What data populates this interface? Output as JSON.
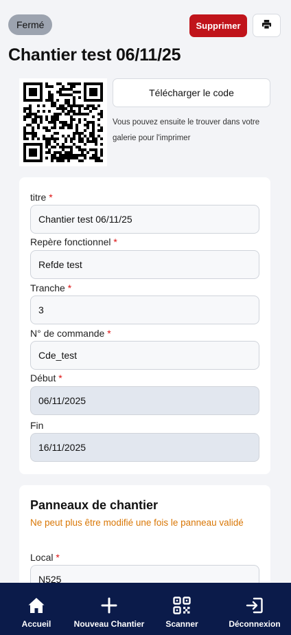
{
  "header": {
    "status": "Fermé",
    "delete_label": "Supprimer",
    "title": "Chantier test 06/11/25"
  },
  "qr": {
    "download_label": "Télécharger le code",
    "hint": "Vous pouvez ensuite le trouver dans votre galerie pour l'imprimer"
  },
  "form": {
    "titre": {
      "label": "titre",
      "required": "*",
      "value": "Chantier test 06/11/25"
    },
    "repere": {
      "label": "Repère fonctionnel",
      "required": "*",
      "value": "Refde test"
    },
    "tranche": {
      "label": "Tranche",
      "required": "*",
      "value": "3"
    },
    "commande": {
      "label": "N° de commande",
      "required": "*",
      "value": "Cde_test"
    },
    "debut": {
      "label": "Début",
      "required": "*",
      "value": "06/11/2025"
    },
    "fin": {
      "label": "Fin",
      "value": "16/11/2025"
    }
  },
  "panels": {
    "title": "Panneaux de chantier",
    "warning": "Ne peut plus être modifié une fois le panneau validé",
    "local": {
      "label": "Local",
      "required": "*",
      "value": "N525"
    }
  },
  "nav": {
    "home": "Accueil",
    "new": "Nouveau Chantier",
    "scan": "Scanner",
    "logout": "Déconnexion"
  },
  "colors": {
    "accent_danger": "#c0141b",
    "nav_bg": "#0b1b4a",
    "warning": "#d97706"
  }
}
